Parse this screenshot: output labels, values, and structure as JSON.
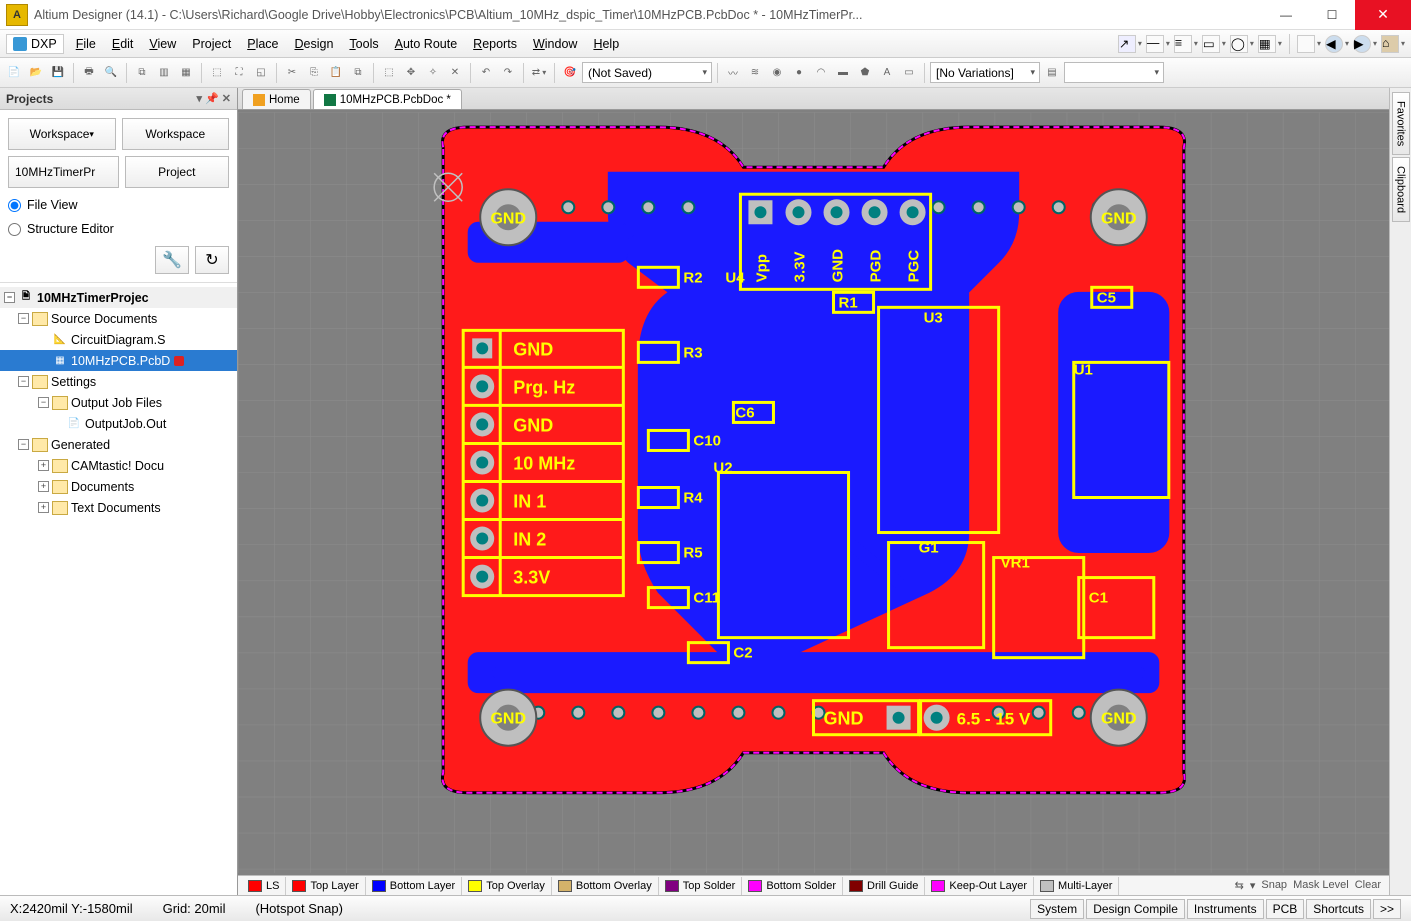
{
  "titlebar": {
    "app_glyph": "A",
    "title": "Altium Designer (14.1) - C:\\Users\\Richard\\Google Drive\\Hobby\\Electronics\\PCB\\Altium_10MHz_dspic_Timer\\10MHzPCB.PcbDoc * - 10MHzTimerPr...",
    "min": "—",
    "max": "☐",
    "close": "✕"
  },
  "menus": [
    "File",
    "Edit",
    "View",
    "Project",
    "Place",
    "Design",
    "Tools",
    "Auto Route",
    "Reports",
    "Window",
    "Help"
  ],
  "dxp_label": "DXP",
  "toolbar2": {
    "not_saved": "(Not Saved)",
    "no_variations": "[No Variations]"
  },
  "projects_panel": {
    "title": "Projects",
    "workspace_dd": "Workspace",
    "workspace_btn": "Workspace",
    "project_name": "10MHzTimerPr",
    "project_btn": "Project",
    "file_view": "File View",
    "structure_editor": "Structure Editor"
  },
  "tree": {
    "root": "10MHzTimerProjec",
    "source_docs": "Source Documents",
    "circuit": "CircuitDiagram.S",
    "pcb": "10MHzPCB.PcbD",
    "settings": "Settings",
    "output_job_files": "Output Job Files",
    "output_job": "OutputJob.Out",
    "generated": "Generated",
    "camtastic": "CAMtastic! Docu",
    "documents": "Documents",
    "text_docs": "Text Documents"
  },
  "doc_tabs": {
    "home": "Home",
    "pcb": "10MHzPCB.PcbDoc *"
  },
  "dock_tabs": [
    "Favorites",
    "Clipboard"
  ],
  "layer_bar": {
    "ls": "LS",
    "layers": [
      {
        "name": "Top Layer",
        "color": "#ff0000"
      },
      {
        "name": "Bottom Layer",
        "color": "#0000ff"
      },
      {
        "name": "Top Overlay",
        "color": "#ffff00"
      },
      {
        "name": "Bottom Overlay",
        "color": "#d4b26a"
      },
      {
        "name": "Top Solder",
        "color": "#800080"
      },
      {
        "name": "Bottom Solder",
        "color": "#ff00ff"
      },
      {
        "name": "Drill Guide",
        "color": "#800000"
      },
      {
        "name": "Keep-Out Layer",
        "color": "#ff00ff"
      },
      {
        "name": "Multi-Layer",
        "color": "#c0c0c0"
      }
    ],
    "snap": "Snap",
    "mask": "Mask Level",
    "clear": "Clear"
  },
  "statusbar": {
    "coords": "X:2420mil Y:-1580mil",
    "grid": "Grid: 20mil",
    "hotspot": "(Hotspot Snap)",
    "buttons": [
      "System",
      "Design Compile",
      "Instruments",
      "PCB",
      "Shortcuts",
      ">>"
    ]
  },
  "pcb": {
    "mounting_holes_label": "GND",
    "header_left": [
      "GND",
      "Prg. Hz",
      "GND",
      "10 MHz",
      "IN 1",
      "IN 2",
      "3.3V"
    ],
    "prog_header_top": [
      "Vpp",
      "3.3V",
      "GND",
      "PGD",
      "PGC"
    ],
    "power_hdr": {
      "gnd": "GND",
      "range": "6.5 - 15 V"
    },
    "designators": {
      "R1": "R1",
      "R2": "R2",
      "R3": "R3",
      "R4": "R4",
      "R5": "R5",
      "C1": "C1",
      "C2": "C2",
      "C5": "C5",
      "C6": "C6",
      "C10": "C10",
      "C11": "C11",
      "U1": "U1",
      "U2": "U2",
      "U3": "U3",
      "U4": "U4",
      "G1": "G1",
      "VR1": "VR1"
    }
  }
}
